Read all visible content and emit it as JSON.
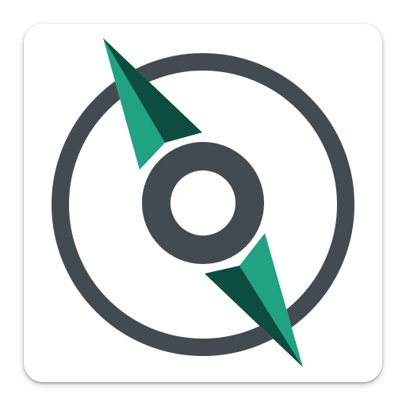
{
  "icon": {
    "name": "compass-app-icon",
    "colors": {
      "tile": "#ffffff",
      "ring": "#444b50",
      "needle_light": "#1fa383",
      "needle_dark": "#0d4d3f"
    }
  }
}
